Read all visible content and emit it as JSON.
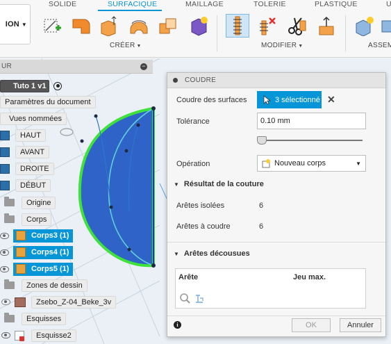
{
  "toolbar": {
    "workspace_label": "ION",
    "tabs": [
      "SOLIDE",
      "SURFACIQUE",
      "MAILLAGE",
      "TOLERIE",
      "PLASTIQUE",
      "U"
    ],
    "active_tab": "SURFACIQUE",
    "groups": {
      "create": "CRÉER",
      "modify": "MODIFIER",
      "assemble": "ASSEM"
    }
  },
  "browser": {
    "header": "UR",
    "root": "Tuto 1 v1",
    "doc_params": "Paramètres du document",
    "named_views": "Vues nommées",
    "views": [
      "HAUT",
      "AVANT",
      "DROITE",
      "DÉBUT"
    ],
    "origin": "Origine",
    "bodies_folder": "Corps",
    "bodies": [
      "Corps3 (1)",
      "Corps4 (1)",
      "Corps5 (1)"
    ],
    "sketch_zones": "Zones de dessin",
    "canvas": "Zsebo_Z-04_Beke_3v",
    "sketches": "Esquisses",
    "sketch2": "Esquisse2"
  },
  "dialog": {
    "title": "COUDRE",
    "stitch_surfaces_label": "Coudre des surfaces",
    "selection_value": "3 sélectionné",
    "tolerance_label": "Tolérance",
    "tolerance_value": "0.10 mm",
    "operation_label": "Opération",
    "operation_value": "Nouveau corps",
    "stitch_result_title": "Résultat de la couture",
    "isolated_edges_label": "Arêtes isolées",
    "isolated_edges_value": "6",
    "edges_to_stitch_label": "Arêtes à coudre",
    "edges_to_stitch_value": "6",
    "unstitched_title": "Arêtes décousues",
    "col_edge": "Arête",
    "col_max_gap": "Jeu max.",
    "ok": "OK",
    "cancel": "Annuler"
  },
  "colors": {
    "accent": "#0696d7",
    "surface_fill": "#2f63c8",
    "edge_highlight": "#3ee23b",
    "body_icon": "#e8a33c"
  }
}
